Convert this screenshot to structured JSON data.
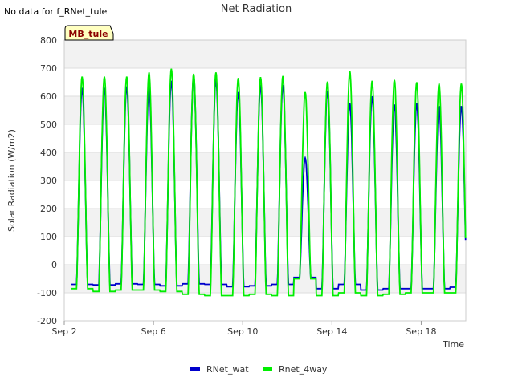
{
  "no_data_note": "No data for f_RNet_tule",
  "site_badge": "MB_tule",
  "chart_data": {
    "type": "line",
    "title": "Net Radiation",
    "xlabel": "Time",
    "ylabel": "Solar Radiation (W/m2)",
    "ylim": [
      -200,
      800
    ],
    "yticks": [
      -200,
      -100,
      0,
      100,
      200,
      300,
      400,
      500,
      600,
      700,
      800
    ],
    "xlim_days": [
      2.0,
      20.0
    ],
    "xtick_days": [
      2,
      6,
      10,
      14,
      18
    ],
    "xtick_labels": [
      "Sep 2",
      "Sep 6",
      "Sep 10",
      "Sep 14",
      "Sep 18"
    ],
    "grid": true,
    "legend_position": "bottom-center",
    "plot_background_bands": [
      "#f2f2f2",
      "#ffffff"
    ],
    "series": [
      {
        "name": "RNet_wat",
        "color": "#0000cc",
        "day_start": 2.3,
        "night": [
          -70,
          -72,
          -68,
          -70,
          -75,
          -68,
          -70,
          -78,
          -75,
          -70,
          -45,
          -85,
          -70,
          -90,
          -85,
          -85,
          -85,
          -80
        ],
        "peak": [
          630,
          630,
          635,
          630,
          655,
          670,
          660,
          615,
          640,
          640,
          380,
          620,
          575,
          600,
          570,
          575,
          565,
          565
        ]
      },
      {
        "name": "Rnet_4way",
        "color": "#00ee00",
        "day_start": 2.3,
        "night": [
          -85,
          -95,
          -90,
          -90,
          -95,
          -105,
          -110,
          -110,
          -105,
          -110,
          -50,
          -110,
          -100,
          -110,
          -105,
          -100,
          -100,
          -100
        ],
        "peak": [
          670,
          670,
          670,
          685,
          698,
          680,
          685,
          665,
          668,
          672,
          615,
          652,
          690,
          655,
          658,
          650,
          645,
          645
        ]
      }
    ]
  }
}
